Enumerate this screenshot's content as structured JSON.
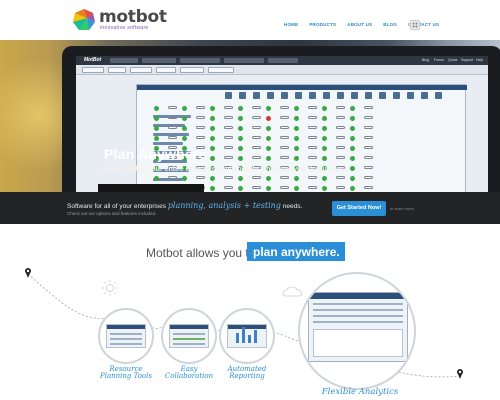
{
  "brand": {
    "name": "motbot",
    "tagline": "innovative software"
  },
  "nav": {
    "items": [
      "HOME",
      "PRODUCTS",
      "ABOUT US",
      "BLOG",
      "CONTACT US"
    ]
  },
  "hero": {
    "app_name": "MotBot",
    "headline": "Plan Anywhere",
    "subheadline": "Motbot helps your entire enterprise collaborate wherever you do business",
    "app_menu": [
      "Blog",
      "Forum",
      "Quote",
      "Support",
      "Help"
    ]
  },
  "cta": {
    "text_prefix": "Software for all of your enterprises",
    "text_script": "planning, analysis + testing",
    "text_suffix": "needs.",
    "small_text": "Check out our options and features included.",
    "button_label": "Get Started Now!",
    "or_text": "or learn more"
  },
  "section": {
    "heading": "Motbot allows you to",
    "highlight": "plan anywhere."
  },
  "features": [
    {
      "label_line1": "Resource",
      "label_line2": "Planning Tools"
    },
    {
      "label_line1": "Easy",
      "label_line2": "Collaboration"
    },
    {
      "label_line1": "Automated",
      "label_line2": "Reporting"
    },
    {
      "label_line1": "Flexible Analytics",
      "label_line2": ""
    }
  ],
  "colors": {
    "accent": "#2a8fd6",
    "dark_strip": "#222426",
    "nav": "#2a86c9"
  }
}
